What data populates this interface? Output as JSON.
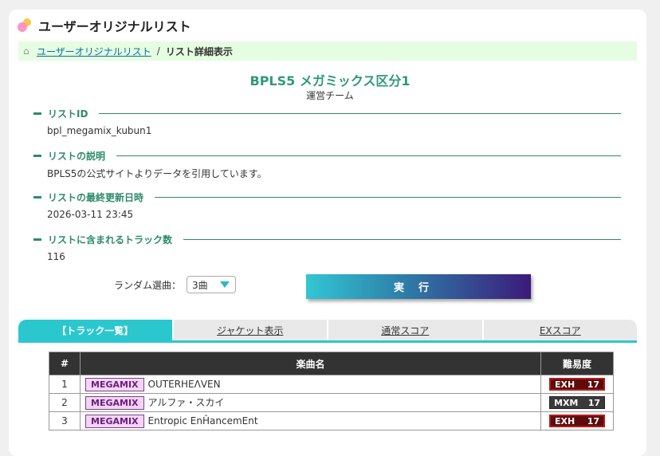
{
  "header": {
    "title": "ユーザーオリジナルリスト"
  },
  "breadcrumb": {
    "home_link": "ユーザーオリジナルリスト",
    "separator": "/",
    "current": "リスト詳細表示"
  },
  "list": {
    "title": "BPLS5 メガミックス区分1",
    "owner": "運営チーム"
  },
  "sections": [
    {
      "label": "リストID",
      "value": "bpl_megamix_kubun1"
    },
    {
      "label": "リストの説明",
      "value": "BPLS5の公式サイトよりデータを引用しています。"
    },
    {
      "label": "リストの最終更新日時",
      "value": "2026-03-11 23:45"
    },
    {
      "label": "リストに含まれるトラック数",
      "value": "116"
    }
  ],
  "random": {
    "label": "ランダム選曲：",
    "selected": "3曲",
    "execute": "実行"
  },
  "tabs": [
    {
      "label": "【トラック一覧】",
      "active": true
    },
    {
      "label": "ジャケット表示",
      "active": false
    },
    {
      "label": "通常スコア",
      "active": false
    },
    {
      "label": "EXスコア",
      "active": false
    }
  ],
  "table": {
    "headers": [
      "#",
      "楽曲名",
      "難易度"
    ],
    "rows": [
      {
        "num": "1",
        "tag": "MEGAMIX",
        "title": "OUTERHEΛVEN",
        "diff": "EXH",
        "level": "17"
      },
      {
        "num": "2",
        "tag": "MEGAMIX",
        "title": "アルファ・スカイ",
        "diff": "MXM",
        "level": "17"
      },
      {
        "num": "3",
        "tag": "MEGAMIX",
        "title": "Entropic EnĤancemEnt",
        "diff": "EXH",
        "level": "17"
      }
    ]
  },
  "colors": {
    "accent": "#2bc7cf",
    "section_green": "#2e8a6c",
    "title_green": "#2e9a79",
    "breadcrumb_bg": "#e5fde0"
  }
}
